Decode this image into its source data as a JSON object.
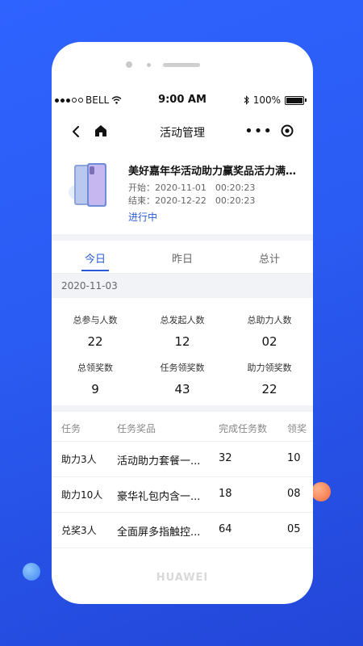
{
  "status_bar": {
    "carrier": "BELL",
    "time": "9:00 AM",
    "battery": "100%"
  },
  "nav": {
    "title": "活动管理",
    "more": "•••"
  },
  "activity": {
    "title": "美好嘉年华活动助力赢奖品活力满满...",
    "start": "开始：2020-11-01　00:20:23",
    "end": "结束：2020-12-22　00:20:23",
    "status": "进行中"
  },
  "tabs": [
    "今日",
    "昨日",
    "总计"
  ],
  "date": "2020-11-03",
  "stats": [
    {
      "label": "总参与人数",
      "value": "22"
    },
    {
      "label": "总发起人数",
      "value": "12"
    },
    {
      "label": "总助力人数",
      "value": "02"
    },
    {
      "label": "总领奖数",
      "value": "9"
    },
    {
      "label": "任务领奖数",
      "value": "43"
    },
    {
      "label": "助力领奖数",
      "value": "22"
    }
  ],
  "table": {
    "headers": [
      "任务",
      "任务奖品",
      "完成任务数",
      "领奖"
    ],
    "rows": [
      [
        "助力3人",
        "活动助力套餐一...",
        "32",
        "10"
      ],
      [
        "助力10人",
        "豪华礼包内含一...",
        "18",
        "08"
      ],
      [
        "兑奖3人",
        "全面屏多指触控...",
        "64",
        "05"
      ]
    ]
  },
  "brand": "HUAWEI",
  "colors": {
    "accent": "#2a5bd7",
    "background": "#2f63ff"
  }
}
